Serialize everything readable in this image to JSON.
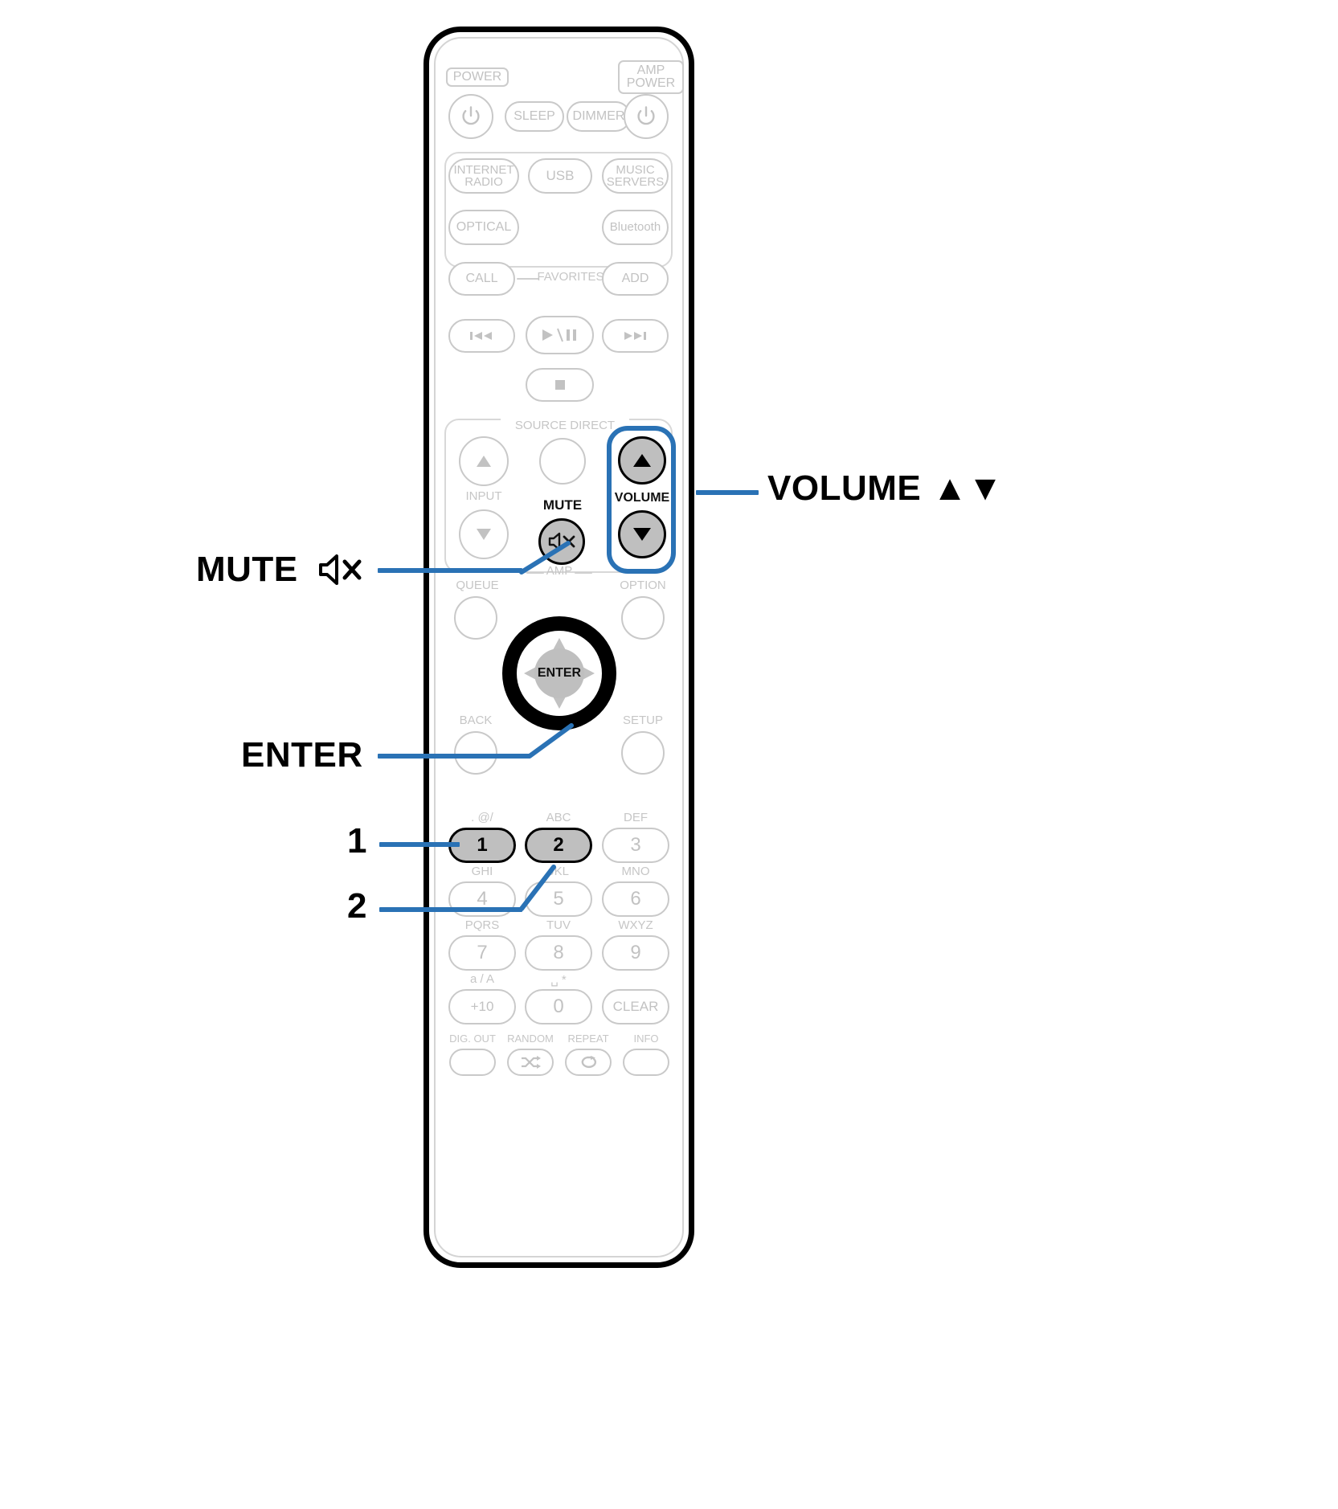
{
  "diagram": {
    "device": "remote control unit",
    "accent_color": "#2a72b5",
    "highlight_fill": "#bfbfbf"
  },
  "remote": {
    "power_group_label": "POWER",
    "amp_power_label": "AMP POWER",
    "row_power": [
      {
        "name": "power",
        "label": "",
        "icon": "power-icon"
      },
      {
        "name": "sleep",
        "label": "SLEEP"
      },
      {
        "name": "dimmer",
        "label": "DIMMER"
      },
      {
        "name": "amp-power",
        "label": "",
        "icon": "power-icon"
      }
    ],
    "sources": [
      {
        "name": "internet-radio",
        "label": "INTERNET\nRADIO",
        "line1": "INTERNET",
        "line2": "RADIO"
      },
      {
        "name": "usb",
        "label": "USB"
      },
      {
        "name": "music-servers",
        "label": "MUSIC\nSERVERS",
        "line1": "MUSIC",
        "line2": "SERVERS"
      },
      {
        "name": "optical",
        "label": "OPTICAL"
      },
      {
        "name": "bluetooth",
        "label": "Bluetooth"
      }
    ],
    "favorites": {
      "call_label": "CALL",
      "center_label": "FAVORITES",
      "add_label": "ADD"
    },
    "transport": [
      {
        "name": "previous",
        "glyph": "skip-back-icon"
      },
      {
        "name": "play-pause",
        "glyph": "play-pause-icon"
      },
      {
        "name": "next",
        "glyph": "skip-forward-icon"
      },
      {
        "name": "stop",
        "glyph": "stop-icon"
      }
    ],
    "amp_section": {
      "source_direct_label": "SOURCE DIRECT",
      "input_label": "INPUT",
      "volume_label": "VOLUME",
      "mute_label": "MUTE",
      "amp_bracket_label": "AMP"
    },
    "nav": {
      "queue_label": "QUEUE",
      "option_label": "OPTION",
      "back_label": "BACK",
      "setup_label": "SETUP",
      "enter_label": "ENTER"
    },
    "keypad": [
      {
        "name": "key-1",
        "digit": "1",
        "letters": ". @/",
        "highlighted": true
      },
      {
        "name": "key-2",
        "digit": "2",
        "letters": "ABC",
        "highlighted": true
      },
      {
        "name": "key-3",
        "digit": "3",
        "letters": "DEF",
        "highlighted": false
      },
      {
        "name": "key-4",
        "digit": "4",
        "letters": "GHI",
        "highlighted": false
      },
      {
        "name": "key-5",
        "digit": "5",
        "letters": "JKL",
        "highlighted": false
      },
      {
        "name": "key-6",
        "digit": "6",
        "letters": "MNO",
        "highlighted": false
      },
      {
        "name": "key-7",
        "digit": "7",
        "letters": "PQRS",
        "highlighted": false
      },
      {
        "name": "key-8",
        "digit": "8",
        "letters": "TUV",
        "highlighted": false
      },
      {
        "name": "key-9",
        "digit": "9",
        "letters": "WXYZ",
        "highlighted": false
      },
      {
        "name": "key-plus10",
        "digit": "+10",
        "letters": "a / A",
        "highlighted": false
      },
      {
        "name": "key-0",
        "digit": "0",
        "letters": "␣ *",
        "highlighted": false
      },
      {
        "name": "key-clear",
        "digit": "CLEAR",
        "letters": "",
        "highlighted": false
      }
    ],
    "function_row": [
      {
        "name": "dig-out",
        "label": "DIG. OUT",
        "glyph": ""
      },
      {
        "name": "random",
        "label": "RANDOM",
        "glyph": "shuffle-icon"
      },
      {
        "name": "repeat",
        "label": "REPEAT",
        "glyph": "repeat-icon"
      },
      {
        "name": "info",
        "label": "INFO",
        "glyph": ""
      }
    ]
  },
  "callouts": {
    "volume": "VOLUME",
    "volume_arrows": "▲▼",
    "mute": "MUTE",
    "enter": "ENTER",
    "one": "1",
    "two": "2"
  }
}
